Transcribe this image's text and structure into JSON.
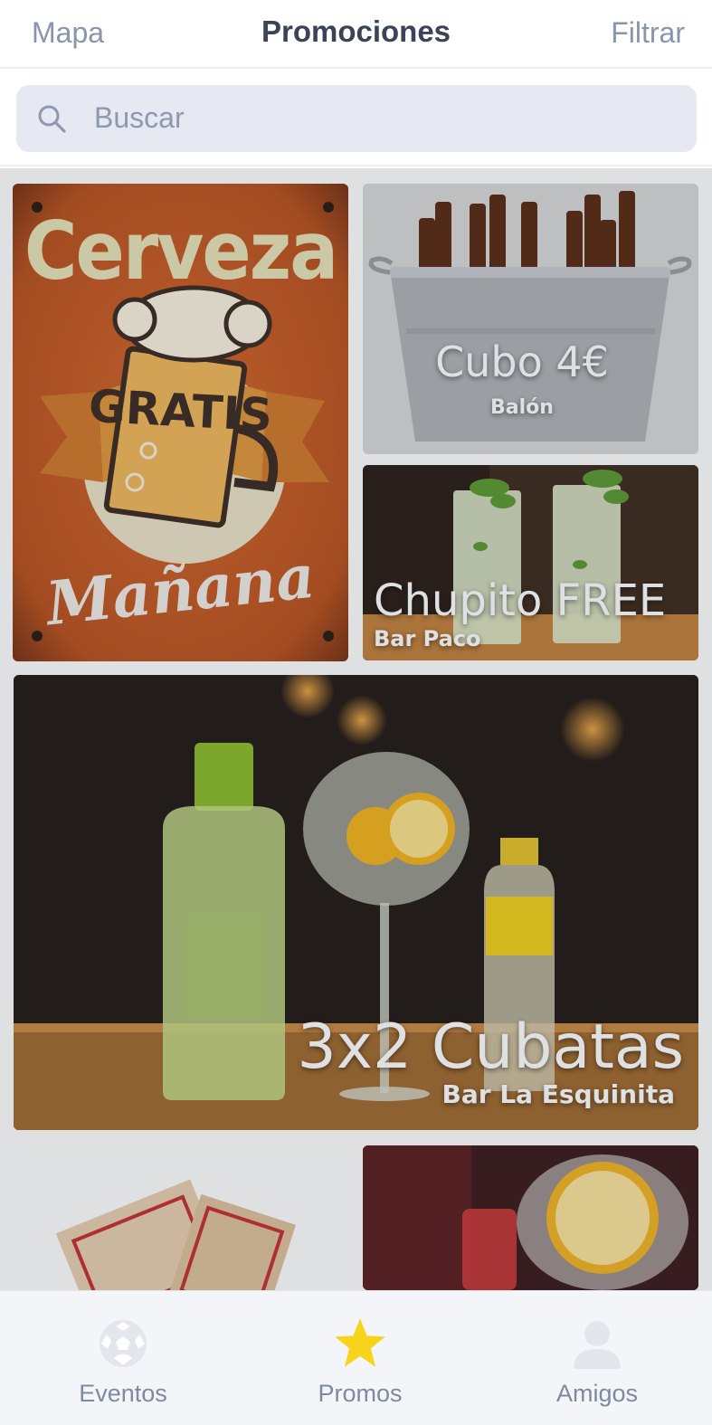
{
  "header": {
    "left_label": "Mapa",
    "title": "Promociones",
    "right_label": "Filtrar"
  },
  "search": {
    "placeholder": "Buscar",
    "icon": "search-icon"
  },
  "promos": {
    "cerveza": {
      "line1": "Cerveza",
      "line2": "GRATIS",
      "line3": "Mañana"
    },
    "cubo": {
      "title": "Cubo 4€",
      "subtitle": "Balón"
    },
    "chupito": {
      "title": "Chupito FREE",
      "subtitle": "Bar Paco"
    },
    "cubatas": {
      "title": "3x2 Cubatas",
      "subtitle": "Bar La Esquinita"
    }
  },
  "tabbar": {
    "tabs": [
      {
        "label": "Eventos",
        "icon": "soccer-ball-icon"
      },
      {
        "label": "Promos",
        "icon": "star-icon",
        "active_color": "#f7d31b"
      },
      {
        "label": "Amigos",
        "icon": "user-icon"
      }
    ]
  }
}
